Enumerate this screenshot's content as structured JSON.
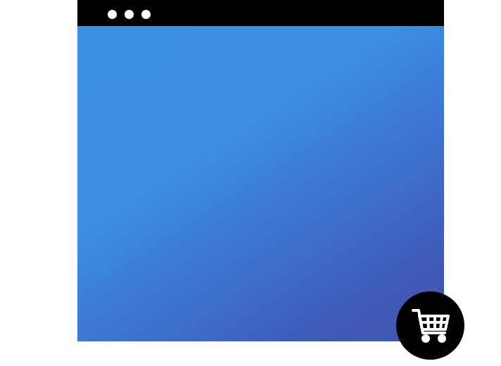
{
  "window": {
    "titlebar_color": "#000000",
    "titlebar_dots": [
      "dot",
      "dot",
      "dot"
    ],
    "dot_color": "#ffffff"
  },
  "viewport": {
    "gradient_start": "#3a8fe3",
    "gradient_end": "#4158b6"
  },
  "cart_button": {
    "icon": "shopping-cart-icon",
    "background": "#000000",
    "icon_color": "#ffffff"
  }
}
